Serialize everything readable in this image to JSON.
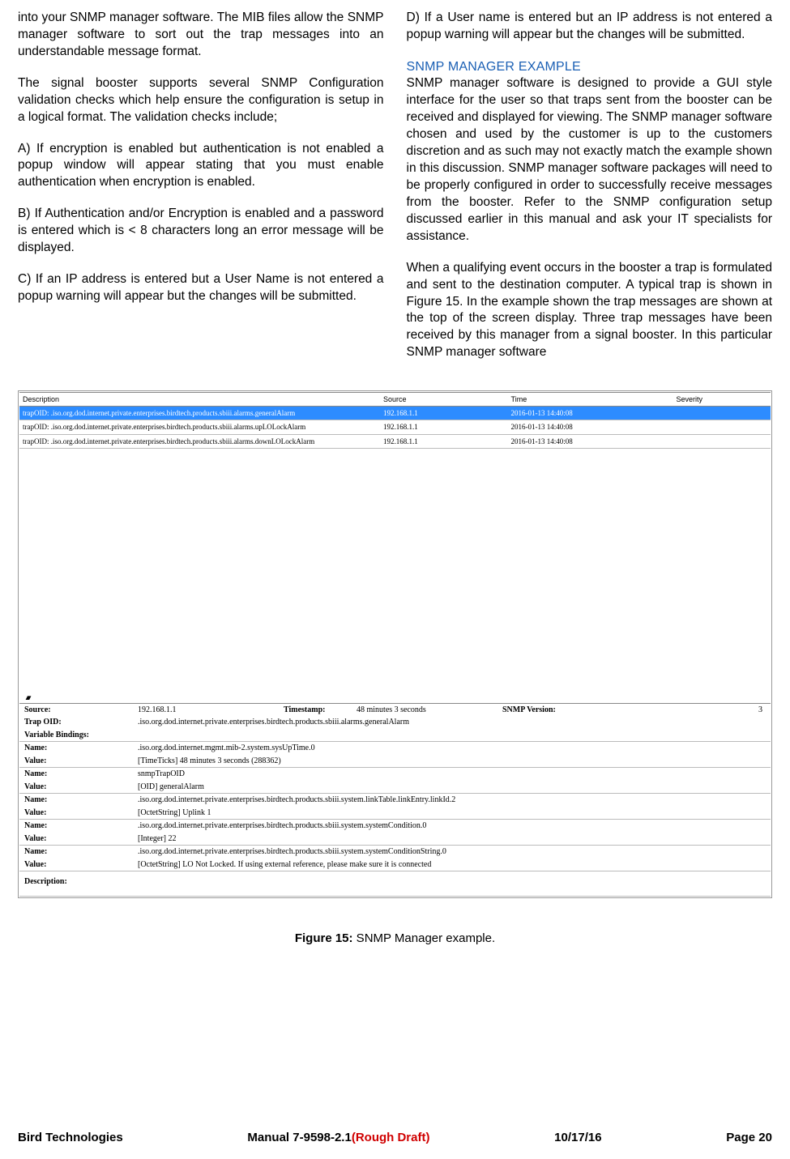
{
  "left": {
    "p1": "into your SNMP manager software. The MIB files allow the SNMP manager software to sort out the trap messages into an understandable message format.",
    "p2": "The signal booster supports several SNMP Configuration validation checks which help ensure the configuration is setup in a logical format. The validation checks include;",
    "A": "A)  If encryption is enabled but authentication is not enabled a popup window will appear stating that you must enable authentication when encryption is enabled.",
    "B": "B)  If Authentication and/or Encryption is enabled and a password is entered which is < 8 characters long an error message will be displayed.",
    "C": "C) If an IP address is entered but a User Name is not entered a popup warning will appear but the changes will be submitted."
  },
  "right": {
    "D": "D) If a User name is entered but an IP address is not entered a popup warning will appear but the changes will be submitted.",
    "heading": "SNMP MANAGER EXAMPLE",
    "p1": "SNMP manager software is designed to provide a GUI style interface for the user so that traps sent from the booster can be received and displayed for viewing. The SNMP manager software chosen and used by the customer is up to the customers discretion and as such may not exactly match the example shown in this discussion. SNMP manager software packages will need to be properly configured in order to successfully receive messages from the booster. Refer to the SNMP configuration setup discussed earlier in this manual and ask your IT specialists for assistance.",
    "p2": "When a qualifying event occurs in the booster a trap is formulated and sent to the destination computer. A typical trap is shown in Figure 15. In the example shown the trap messages are shown at the top of the screen display. Three trap messages have been received by this manager from a signal booster. In this particular SNMP manager software"
  },
  "trapTable": {
    "headers": [
      "Description",
      "Source",
      "Time",
      "Severity"
    ],
    "rows": [
      {
        "desc": "trapOID: .iso.org.dod.internet.private.enterprises.birdtech.products.sbiii.alarms.generalAlarm",
        "src": "192.168.1.1",
        "time": "2016-01-13 14:40:08",
        "sev": "",
        "selected": true
      },
      {
        "desc": "trapOID: .iso.org.dod.internet.private.enterprises.birdtech.products.sbiii.alarms.upLOLockAlarm",
        "src": "192.168.1.1",
        "time": "2016-01-13 14:40:08",
        "sev": "",
        "selected": false
      },
      {
        "desc": "trapOID: .iso.org.dod.internet.private.enterprises.birdtech.products.sbiii.alarms.downLOLockAlarm",
        "src": "192.168.1.1",
        "time": "2016-01-13 14:40:08",
        "sev": "",
        "selected": false
      }
    ]
  },
  "detail": {
    "sourceLabel": "Source:",
    "sourceVal": "192.168.1.1",
    "timestampLabel": "Timestamp:",
    "timestampVal": "48 minutes 3 seconds",
    "versionLabel": "SNMP Version:",
    "versionVal": "3",
    "trapOidLabel": "Trap OID:",
    "trapOidVal": ".iso.org.dod.internet.private.enterprises.birdtech.products.sbiii.alarms.generalAlarm",
    "varBindLabel": "Variable Bindings:",
    "bindings": [
      {
        "name": ".iso.org.dod.internet.mgmt.mib-2.system.sysUpTime.0",
        "value": "[TimeTicks] 48 minutes 3 seconds (288362)"
      },
      {
        "name": "snmpTrapOID",
        "value": "[OID] generalAlarm"
      },
      {
        "name": ".iso.org.dod.internet.private.enterprises.birdtech.products.sbiii.system.linkTable.linkEntry.linkId.2",
        "value": "[OctetString] Uplink 1"
      },
      {
        "name": ".iso.org.dod.internet.private.enterprises.birdtech.products.sbiii.system.systemCondition.0",
        "value": "[Integer] 22"
      },
      {
        "name": ".iso.org.dod.internet.private.enterprises.birdtech.products.sbiii.system.systemConditionString.0",
        "value": "[OctetString] LO Not Locked.  If using external reference, please make sure it is connected"
      }
    ],
    "nameLabel": "Name:",
    "valueLabel": "Value:",
    "descriptionLabel": "Description:"
  },
  "caption": {
    "bold": "Figure 15:",
    "rest": " SNMP Manager example."
  },
  "footer": {
    "left": "Bird Technologies",
    "mid_a": "Manual 7-9598-2.1",
    "mid_b": "(Rough Draft)",
    "date": "10/17/16",
    "page": "Page 20"
  }
}
